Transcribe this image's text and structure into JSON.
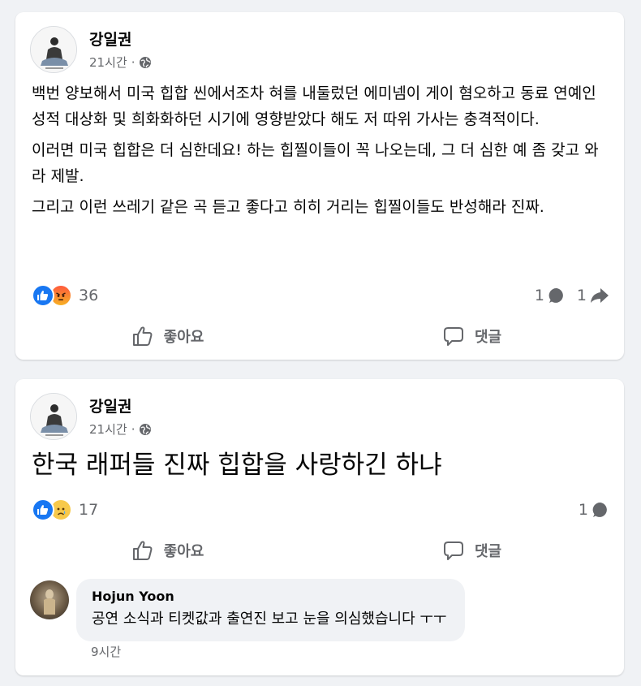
{
  "colors": {
    "page_background": "#f0f2f5",
    "card_background": "#ffffff",
    "like_blue": "#1877f2",
    "secondary_text": "#65676b"
  },
  "posts": [
    {
      "author": "강일권",
      "timestamp": "21시간",
      "separator": "·",
      "privacy_icon": "globe-icon",
      "paragraphs": [
        "백번 양보해서 미국 힙합 씬에서조차 혀를 내둘렀던 에미넴이 게이 혐오하고 동료 연예인 성적 대상화 및 희화화하던 시기에 영향받았다 해도 저 따위 가사는 충격적이다.",
        "이러면 미국 힙합은 더 심한데요!  하는 힙찔이들이 꼭 나오는데, 그 더 심한 예 좀 갖고 와라 제발.",
        "그리고 이런 쓰레기 같은 곡 듣고 좋다고 히히 거리는 힙찔이들도 반성해라 진짜."
      ],
      "reactions": [
        "like-icon",
        "angry-icon"
      ],
      "reaction_count": "36",
      "comment_count": "1",
      "share_count": "1",
      "like_label": "좋아요",
      "comment_label": "댓글"
    },
    {
      "author": "강일권",
      "timestamp": "21시간",
      "separator": "·",
      "privacy_icon": "globe-icon",
      "text": "한국 래퍼들 진짜 힙합을 사랑하긴 하냐",
      "reactions": [
        "like-icon",
        "sad-icon"
      ],
      "reaction_count": "17",
      "comment_count": "1",
      "like_label": "좋아요",
      "comment_label": "댓글",
      "comment": {
        "author": "Hojun Yoon",
        "text": "공연 소식과 티켓값과 출연진 보고 눈을 의심했습니다 ㅜㅜ",
        "timestamp": "9시간"
      }
    }
  ]
}
